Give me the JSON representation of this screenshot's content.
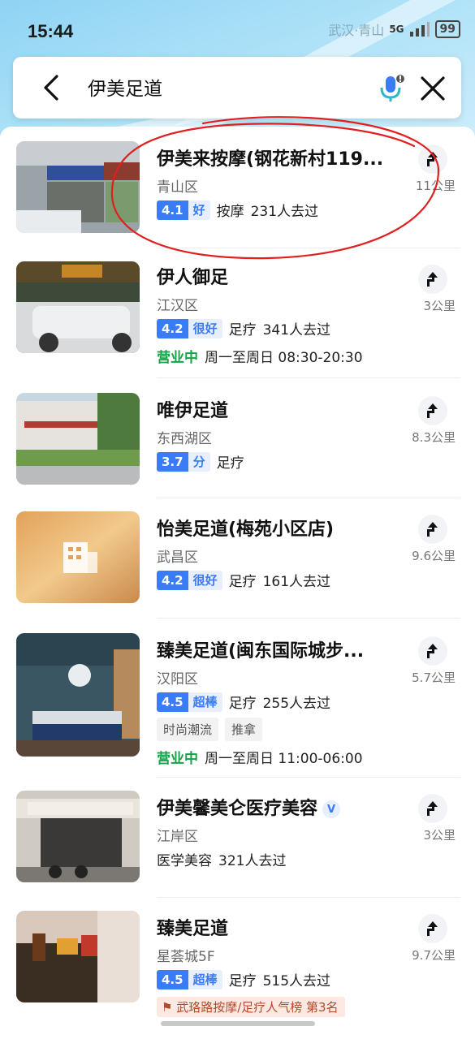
{
  "status_bar": {
    "time": "15:44",
    "network": "5G",
    "map_label": "武汉·青山",
    "battery": "99"
  },
  "search": {
    "query": "伊美足道",
    "icons": {
      "back": "back-arrow-icon",
      "mic": "microphone-icon",
      "close": "close-icon"
    }
  },
  "results": [
    {
      "name": "伊美来按摩(钢花新村119...",
      "district": "青山区",
      "distance": "11公里",
      "score": "4.1",
      "level": "好",
      "category": "按摩",
      "visits": "231人去过"
    },
    {
      "name": "伊人御足",
      "district": "江汉区",
      "distance": "3公里",
      "score": "4.2",
      "level": "很好",
      "category": "足疗",
      "visits": "341人去过",
      "status": "营业中",
      "hours": "周一至周日 08:30-20:30"
    },
    {
      "name": "唯伊足道",
      "district": "东西湖区",
      "distance": "8.3公里",
      "score": "3.7",
      "level": "分",
      "category": "足疗"
    },
    {
      "name": "怡美足道(梅苑小区店)",
      "district": "武昌区",
      "distance": "9.6公里",
      "score": "4.2",
      "level": "很好",
      "category": "足疗",
      "visits": "161人去过"
    },
    {
      "name": "臻美足道(闽东国际城步...",
      "district": "汉阳区",
      "distance": "5.7公里",
      "score": "4.5",
      "level": "超棒",
      "category": "足疗",
      "visits": "255人去过",
      "tags": [
        "时尚潮流",
        "推拿"
      ],
      "status": "营业中",
      "hours": "周一至周日 11:00-06:00"
    },
    {
      "name": "伊美馨美仑医疗美容",
      "verified": "V",
      "district": "江岸区",
      "distance": "3公里",
      "category": "医学美容",
      "visits": "321人去过"
    },
    {
      "name": "臻美足道",
      "district": "星荟城5F",
      "distance": "9.7公里",
      "score": "4.5",
      "level": "超棒",
      "category": "足疗",
      "visits": "515人去过",
      "rank": "武珞路按摩/足疗人气榜 第3名"
    }
  ],
  "colors": {
    "accent": "#3a7cf6",
    "open_green": "#17a34a",
    "annotation_red": "#e02020"
  }
}
